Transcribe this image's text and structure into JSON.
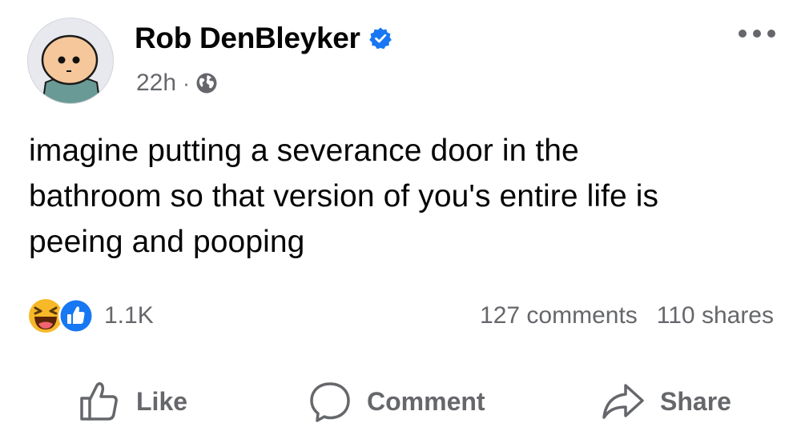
{
  "post": {
    "author": "Rob DenBleyker",
    "verified": true,
    "timestamp": "22h",
    "separator": "·",
    "audience_icon": "globe-icon",
    "text_lines": [
      "imagine putting a severance door in the",
      "bathroom so that version of you's entire life is",
      "peeing and pooping"
    ]
  },
  "stats": {
    "reaction_icons": [
      "haha-reaction-icon",
      "like-reaction-icon"
    ],
    "reaction_count": "1.1K",
    "comments": "127 comments",
    "shares": "110 shares"
  },
  "actions": {
    "like_label": "Like",
    "comment_label": "Comment",
    "share_label": "Share"
  },
  "colors": {
    "text_primary": "#050505",
    "text_secondary": "#65676b",
    "verified_blue": "#1877f2",
    "like_blue": "#1877f2",
    "haha_yellow": "#f7b928"
  }
}
